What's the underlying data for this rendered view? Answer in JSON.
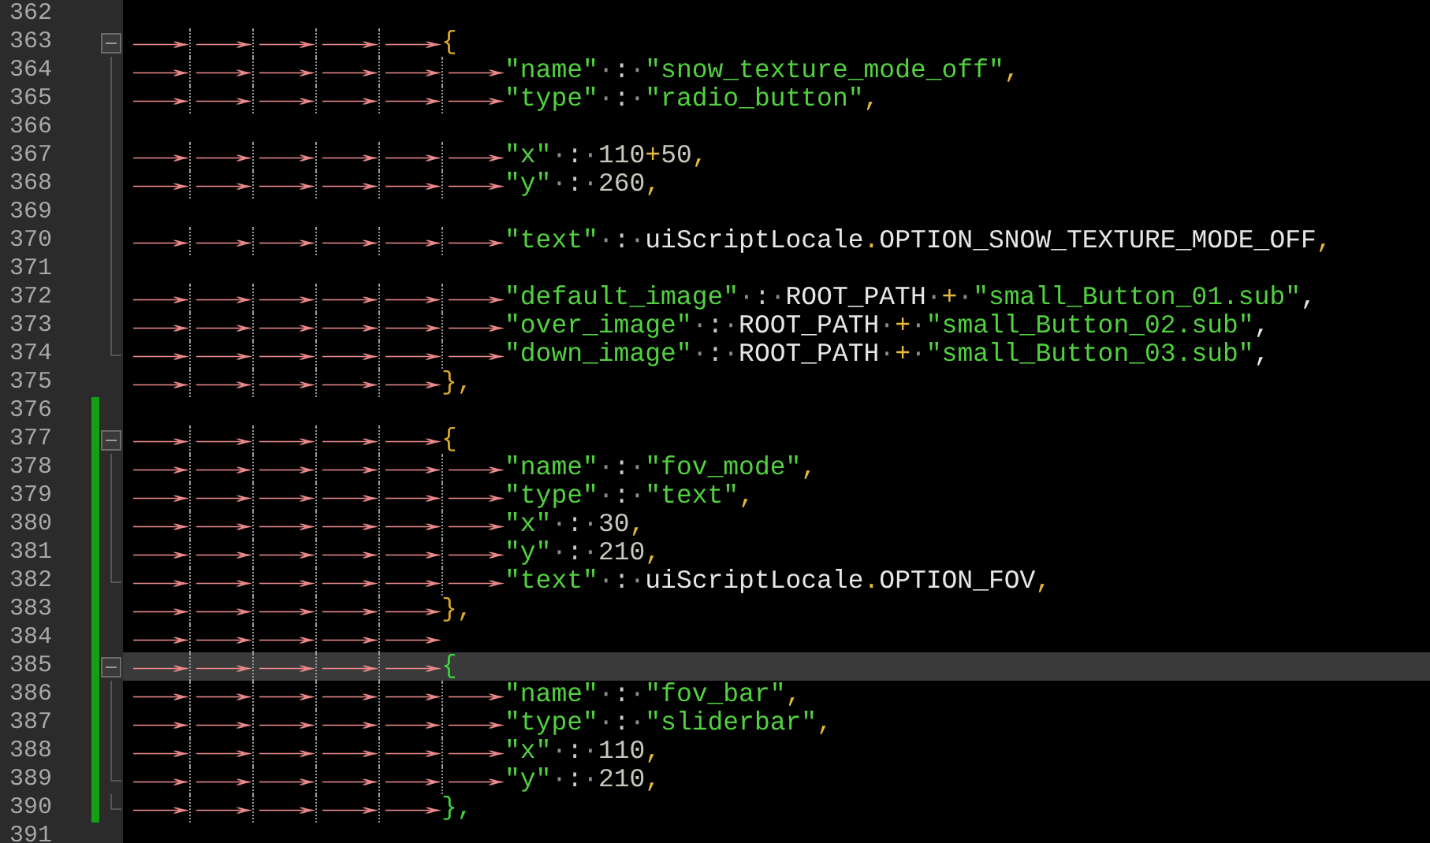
{
  "editor": {
    "lines": [
      {
        "number": "362",
        "expanded": false,
        "in_fold": false,
        "fold_end": false,
        "changed": false,
        "current": false
      },
      {
        "number": "363",
        "tokens": [
          {
            "text": "→",
            "kind": "tab"
          },
          {
            "text": "→",
            "kind": "tab"
          },
          {
            "text": "→",
            "kind": "tab"
          },
          {
            "text": "→",
            "kind": "tab"
          },
          {
            "text": "→",
            "kind": "tab"
          },
          {
            "text": "{",
            "kind": "brace"
          }
        ],
        "expanded": true,
        "in_fold": false,
        "fold_end": false,
        "changed": false,
        "current": false
      },
      {
        "number": "364",
        "tokens": [
          {
            "text": "→",
            "kind": "tab"
          },
          {
            "text": "→",
            "kind": "tab"
          },
          {
            "text": "→",
            "kind": "tab"
          },
          {
            "text": "→",
            "kind": "tab"
          },
          {
            "text": "→",
            "kind": "tab"
          },
          {
            "text": "→",
            "kind": "tab"
          },
          {
            "text": "\"name\"",
            "kind": "string"
          },
          {
            "text": "·",
            "kind": "space"
          },
          {
            "text": ":",
            "kind": "colon"
          },
          {
            "text": "·",
            "kind": "space"
          },
          {
            "text": "\"snow_texture_mode_off\"",
            "kind": "string"
          },
          {
            "text": ",",
            "kind": "operator"
          }
        ],
        "expanded": false,
        "in_fold": true,
        "fold_end": false,
        "changed": false,
        "current": false
      },
      {
        "number": "365",
        "tokens": [
          {
            "text": "→",
            "kind": "tab"
          },
          {
            "text": "→",
            "kind": "tab"
          },
          {
            "text": "→",
            "kind": "tab"
          },
          {
            "text": "→",
            "kind": "tab"
          },
          {
            "text": "→",
            "kind": "tab"
          },
          {
            "text": "→",
            "kind": "tab"
          },
          {
            "text": "\"type\"",
            "kind": "string"
          },
          {
            "text": "·",
            "kind": "space"
          },
          {
            "text": ":",
            "kind": "colon"
          },
          {
            "text": "·",
            "kind": "space"
          },
          {
            "text": "\"radio_button\"",
            "kind": "string"
          },
          {
            "text": ",",
            "kind": "operator"
          }
        ],
        "expanded": false,
        "in_fold": true,
        "fold_end": false,
        "changed": false,
        "current": false
      },
      {
        "number": "366",
        "expanded": false,
        "in_fold": true,
        "fold_end": false,
        "changed": false,
        "current": false
      },
      {
        "number": "367",
        "tokens": [
          {
            "text": "→",
            "kind": "tab"
          },
          {
            "text": "→",
            "kind": "tab"
          },
          {
            "text": "→",
            "kind": "tab"
          },
          {
            "text": "→",
            "kind": "tab"
          },
          {
            "text": "→",
            "kind": "tab"
          },
          {
            "text": "→",
            "kind": "tab"
          },
          {
            "text": "\"x\"",
            "kind": "string"
          },
          {
            "text": "·",
            "kind": "space"
          },
          {
            "text": ":",
            "kind": "colon"
          },
          {
            "text": "·",
            "kind": "space"
          },
          {
            "text": "110",
            "kind": "number"
          },
          {
            "text": "+",
            "kind": "operator"
          },
          {
            "text": "50",
            "kind": "number"
          },
          {
            "text": ",",
            "kind": "operator"
          }
        ],
        "expanded": false,
        "in_fold": true,
        "fold_end": false,
        "changed": false,
        "current": false
      },
      {
        "number": "368",
        "tokens": [
          {
            "text": "→",
            "kind": "tab"
          },
          {
            "text": "→",
            "kind": "tab"
          },
          {
            "text": "→",
            "kind": "tab"
          },
          {
            "text": "→",
            "kind": "tab"
          },
          {
            "text": "→",
            "kind": "tab"
          },
          {
            "text": "→",
            "kind": "tab"
          },
          {
            "text": "\"y\"",
            "kind": "string"
          },
          {
            "text": "·",
            "kind": "space"
          },
          {
            "text": ":",
            "kind": "colon"
          },
          {
            "text": "·",
            "kind": "space"
          },
          {
            "text": "260",
            "kind": "number"
          },
          {
            "text": ",",
            "kind": "operator"
          }
        ],
        "expanded": false,
        "in_fold": true,
        "fold_end": false,
        "changed": false,
        "current": false
      },
      {
        "number": "369",
        "expanded": false,
        "in_fold": true,
        "fold_end": false,
        "changed": false,
        "current": false
      },
      {
        "number": "370",
        "tokens": [
          {
            "text": "→",
            "kind": "tab"
          },
          {
            "text": "→",
            "kind": "tab"
          },
          {
            "text": "→",
            "kind": "tab"
          },
          {
            "text": "→",
            "kind": "tab"
          },
          {
            "text": "→",
            "kind": "tab"
          },
          {
            "text": "→",
            "kind": "tab"
          },
          {
            "text": "\"text\"",
            "kind": "string"
          },
          {
            "text": "·",
            "kind": "space"
          },
          {
            "text": ":",
            "kind": "colon"
          },
          {
            "text": "·",
            "kind": "space"
          },
          {
            "text": "uiScriptLocale",
            "kind": "identifier"
          },
          {
            "text": ".",
            "kind": "operator"
          },
          {
            "text": "OPTION_SNOW_TEXTURE_MODE_OFF",
            "kind": "identifier"
          },
          {
            "text": ",",
            "kind": "operator"
          }
        ],
        "expanded": false,
        "in_fold": true,
        "fold_end": false,
        "changed": false,
        "current": false
      },
      {
        "number": "371",
        "expanded": false,
        "in_fold": true,
        "fold_end": false,
        "changed": false,
        "current": false
      },
      {
        "number": "372",
        "tokens": [
          {
            "text": "→",
            "kind": "tab"
          },
          {
            "text": "→",
            "kind": "tab"
          },
          {
            "text": "→",
            "kind": "tab"
          },
          {
            "text": "→",
            "kind": "tab"
          },
          {
            "text": "→",
            "kind": "tab"
          },
          {
            "text": "→",
            "kind": "tab"
          },
          {
            "text": "\"default_image\"",
            "kind": "string"
          },
          {
            "text": "·",
            "kind": "space"
          },
          {
            "text": ":",
            "kind": "colon"
          },
          {
            "text": "·",
            "kind": "space"
          },
          {
            "text": "ROOT_PATH",
            "kind": "identifier"
          },
          {
            "text": "·",
            "kind": "space"
          },
          {
            "text": "+",
            "kind": "operator"
          },
          {
            "text": "·",
            "kind": "space"
          },
          {
            "text": "\"small_Button_01.sub\"",
            "kind": "string"
          },
          {
            "text": ",",
            "kind": "identifier"
          }
        ],
        "expanded": false,
        "in_fold": true,
        "fold_end": false,
        "changed": false,
        "current": false
      },
      {
        "number": "373",
        "tokens": [
          {
            "text": "→",
            "kind": "tab"
          },
          {
            "text": "→",
            "kind": "tab"
          },
          {
            "text": "→",
            "kind": "tab"
          },
          {
            "text": "→",
            "kind": "tab"
          },
          {
            "text": "→",
            "kind": "tab"
          },
          {
            "text": "→",
            "kind": "tab"
          },
          {
            "text": "\"over_image\"",
            "kind": "string"
          },
          {
            "text": "·",
            "kind": "space"
          },
          {
            "text": ":",
            "kind": "colon"
          },
          {
            "text": "·",
            "kind": "space"
          },
          {
            "text": "ROOT_PATH",
            "kind": "identifier"
          },
          {
            "text": "·",
            "kind": "space"
          },
          {
            "text": "+",
            "kind": "operator"
          },
          {
            "text": "·",
            "kind": "space"
          },
          {
            "text": "\"small_Button_02.sub\"",
            "kind": "string"
          },
          {
            "text": ",",
            "kind": "identifier"
          }
        ],
        "expanded": false,
        "in_fold": true,
        "fold_end": false,
        "changed": false,
        "current": false
      },
      {
        "number": "374",
        "tokens": [
          {
            "text": "→",
            "kind": "tab"
          },
          {
            "text": "→",
            "kind": "tab"
          },
          {
            "text": "→",
            "kind": "tab"
          },
          {
            "text": "→",
            "kind": "tab"
          },
          {
            "text": "→",
            "kind": "tab"
          },
          {
            "text": "→",
            "kind": "tab"
          },
          {
            "text": "\"down_image\"",
            "kind": "string"
          },
          {
            "text": "·",
            "kind": "space"
          },
          {
            "text": ":",
            "kind": "colon"
          },
          {
            "text": "·",
            "kind": "space"
          },
          {
            "text": "ROOT_PATH",
            "kind": "identifier"
          },
          {
            "text": "·",
            "kind": "space"
          },
          {
            "text": "+",
            "kind": "operator"
          },
          {
            "text": "·",
            "kind": "space"
          },
          {
            "text": "\"small_Button_03.sub\"",
            "kind": "string"
          },
          {
            "text": ",",
            "kind": "identifier"
          }
        ],
        "expanded": false,
        "in_fold": true,
        "fold_end": true,
        "changed": false,
        "current": false
      },
      {
        "number": "375",
        "tokens": [
          {
            "text": "→",
            "kind": "tab"
          },
          {
            "text": "→",
            "kind": "tab"
          },
          {
            "text": "→",
            "kind": "tab"
          },
          {
            "text": "→",
            "kind": "tab"
          },
          {
            "text": "→",
            "kind": "tab"
          },
          {
            "text": "},",
            "kind": "brace"
          }
        ],
        "expanded": false,
        "in_fold": false,
        "fold_end": false,
        "changed": false,
        "current": false
      },
      {
        "number": "376",
        "expanded": false,
        "in_fold": false,
        "fold_end": false,
        "changed": true,
        "current": false
      },
      {
        "number": "377",
        "tokens": [
          {
            "text": "→",
            "kind": "tab"
          },
          {
            "text": "→",
            "kind": "tab"
          },
          {
            "text": "→",
            "kind": "tab"
          },
          {
            "text": "→",
            "kind": "tab"
          },
          {
            "text": "→",
            "kind": "tab"
          },
          {
            "text": "{",
            "kind": "brace"
          }
        ],
        "expanded": true,
        "in_fold": false,
        "fold_end": false,
        "changed": true,
        "current": false
      },
      {
        "number": "378",
        "tokens": [
          {
            "text": "→",
            "kind": "tab"
          },
          {
            "text": "→",
            "kind": "tab"
          },
          {
            "text": "→",
            "kind": "tab"
          },
          {
            "text": "→",
            "kind": "tab"
          },
          {
            "text": "→",
            "kind": "tab"
          },
          {
            "text": "→",
            "kind": "tab"
          },
          {
            "text": "\"name\"",
            "kind": "string"
          },
          {
            "text": "·",
            "kind": "space"
          },
          {
            "text": ":",
            "kind": "colon"
          },
          {
            "text": "·",
            "kind": "space"
          },
          {
            "text": "\"fov_mode\"",
            "kind": "string"
          },
          {
            "text": ",",
            "kind": "operator"
          }
        ],
        "expanded": false,
        "in_fold": true,
        "fold_end": false,
        "changed": true,
        "current": false
      },
      {
        "number": "379",
        "tokens": [
          {
            "text": "→",
            "kind": "tab"
          },
          {
            "text": "→",
            "kind": "tab"
          },
          {
            "text": "→",
            "kind": "tab"
          },
          {
            "text": "→",
            "kind": "tab"
          },
          {
            "text": "→",
            "kind": "tab"
          },
          {
            "text": "→",
            "kind": "tab"
          },
          {
            "text": "\"type\"",
            "kind": "string"
          },
          {
            "text": "·",
            "kind": "space"
          },
          {
            "text": ":",
            "kind": "colon"
          },
          {
            "text": "·",
            "kind": "space"
          },
          {
            "text": "\"text\"",
            "kind": "string"
          },
          {
            "text": ",",
            "kind": "operator"
          }
        ],
        "expanded": false,
        "in_fold": true,
        "fold_end": false,
        "changed": true,
        "current": false
      },
      {
        "number": "380",
        "tokens": [
          {
            "text": "→",
            "kind": "tab"
          },
          {
            "text": "→",
            "kind": "tab"
          },
          {
            "text": "→",
            "kind": "tab"
          },
          {
            "text": "→",
            "kind": "tab"
          },
          {
            "text": "→",
            "kind": "tab"
          },
          {
            "text": "→",
            "kind": "tab"
          },
          {
            "text": "\"x\"",
            "kind": "string"
          },
          {
            "text": "·",
            "kind": "space"
          },
          {
            "text": ":",
            "kind": "colon"
          },
          {
            "text": "·",
            "kind": "space"
          },
          {
            "text": "30",
            "kind": "number"
          },
          {
            "text": ",",
            "kind": "operator"
          }
        ],
        "expanded": false,
        "in_fold": true,
        "fold_end": false,
        "changed": true,
        "current": false
      },
      {
        "number": "381",
        "tokens": [
          {
            "text": "→",
            "kind": "tab"
          },
          {
            "text": "→",
            "kind": "tab"
          },
          {
            "text": "→",
            "kind": "tab"
          },
          {
            "text": "→",
            "kind": "tab"
          },
          {
            "text": "→",
            "kind": "tab"
          },
          {
            "text": "→",
            "kind": "tab"
          },
          {
            "text": "\"y\"",
            "kind": "string"
          },
          {
            "text": "·",
            "kind": "space"
          },
          {
            "text": ":",
            "kind": "colon"
          },
          {
            "text": "·",
            "kind": "space"
          },
          {
            "text": "210",
            "kind": "number"
          },
          {
            "text": ",",
            "kind": "operator"
          }
        ],
        "expanded": false,
        "in_fold": true,
        "fold_end": false,
        "changed": true,
        "current": false
      },
      {
        "number": "382",
        "tokens": [
          {
            "text": "→",
            "kind": "tab"
          },
          {
            "text": "→",
            "kind": "tab"
          },
          {
            "text": "→",
            "kind": "tab"
          },
          {
            "text": "→",
            "kind": "tab"
          },
          {
            "text": "→",
            "kind": "tab"
          },
          {
            "text": "→",
            "kind": "tab"
          },
          {
            "text": "\"text\"",
            "kind": "string"
          },
          {
            "text": "·",
            "kind": "space"
          },
          {
            "text": ":",
            "kind": "colon"
          },
          {
            "text": "·",
            "kind": "space"
          },
          {
            "text": "uiScriptLocale",
            "kind": "identifier"
          },
          {
            "text": ".",
            "kind": "operator"
          },
          {
            "text": "OPTION_FOV",
            "kind": "identifier"
          },
          {
            "text": ",",
            "kind": "operator"
          }
        ],
        "expanded": false,
        "in_fold": true,
        "fold_end": true,
        "changed": true,
        "current": false
      },
      {
        "number": "383",
        "tokens": [
          {
            "text": "→",
            "kind": "tab"
          },
          {
            "text": "→",
            "kind": "tab"
          },
          {
            "text": "→",
            "kind": "tab"
          },
          {
            "text": "→",
            "kind": "tab"
          },
          {
            "text": "→",
            "kind": "tab"
          },
          {
            "text": "},",
            "kind": "brace"
          }
        ],
        "expanded": false,
        "in_fold": false,
        "fold_end": false,
        "changed": true,
        "current": false
      },
      {
        "number": "384",
        "tokens": [
          {
            "text": "→",
            "kind": "tab"
          },
          {
            "text": "→",
            "kind": "tab"
          },
          {
            "text": "→",
            "kind": "tab"
          },
          {
            "text": "→",
            "kind": "tab"
          },
          {
            "text": "→",
            "kind": "tab"
          }
        ],
        "expanded": false,
        "in_fold": false,
        "fold_end": false,
        "changed": true,
        "current": false
      },
      {
        "number": "385",
        "tokens": [
          {
            "text": "→",
            "kind": "tab"
          },
          {
            "text": "→",
            "kind": "tab"
          },
          {
            "text": "→",
            "kind": "tab"
          },
          {
            "text": "→",
            "kind": "tab"
          },
          {
            "text": "→",
            "kind": "tab"
          },
          {
            "text": "{",
            "kind": "brace-match"
          }
        ],
        "expanded": true,
        "in_fold": false,
        "fold_end": false,
        "changed": true,
        "current": true
      },
      {
        "number": "386",
        "tokens": [
          {
            "text": "→",
            "kind": "tab"
          },
          {
            "text": "→",
            "kind": "tab"
          },
          {
            "text": "→",
            "kind": "tab"
          },
          {
            "text": "→",
            "kind": "tab"
          },
          {
            "text": "→",
            "kind": "tab"
          },
          {
            "text": "→",
            "kind": "tab"
          },
          {
            "text": "\"name\"",
            "kind": "string"
          },
          {
            "text": "·",
            "kind": "space"
          },
          {
            "text": ":",
            "kind": "colon"
          },
          {
            "text": "·",
            "kind": "space"
          },
          {
            "text": "\"fov_bar\"",
            "kind": "string"
          },
          {
            "text": ",",
            "kind": "operator"
          }
        ],
        "expanded": false,
        "in_fold": true,
        "fold_end": false,
        "changed": true,
        "current": false
      },
      {
        "number": "387",
        "tokens": [
          {
            "text": "→",
            "kind": "tab"
          },
          {
            "text": "→",
            "kind": "tab"
          },
          {
            "text": "→",
            "kind": "tab"
          },
          {
            "text": "→",
            "kind": "tab"
          },
          {
            "text": "→",
            "kind": "tab"
          },
          {
            "text": "→",
            "kind": "tab"
          },
          {
            "text": "\"type\"",
            "kind": "string"
          },
          {
            "text": "·",
            "kind": "space"
          },
          {
            "text": ":",
            "kind": "colon"
          },
          {
            "text": "·",
            "kind": "space"
          },
          {
            "text": "\"sliderbar\"",
            "kind": "string"
          },
          {
            "text": ",",
            "kind": "operator"
          }
        ],
        "expanded": false,
        "in_fold": true,
        "fold_end": false,
        "changed": true,
        "current": false
      },
      {
        "number": "388",
        "tokens": [
          {
            "text": "→",
            "kind": "tab"
          },
          {
            "text": "→",
            "kind": "tab"
          },
          {
            "text": "→",
            "kind": "tab"
          },
          {
            "text": "→",
            "kind": "tab"
          },
          {
            "text": "→",
            "kind": "tab"
          },
          {
            "text": "→",
            "kind": "tab"
          },
          {
            "text": "\"x\"",
            "kind": "string"
          },
          {
            "text": "·",
            "kind": "space"
          },
          {
            "text": ":",
            "kind": "colon"
          },
          {
            "text": "·",
            "kind": "space"
          },
          {
            "text": "110",
            "kind": "number"
          },
          {
            "text": ",",
            "kind": "operator"
          }
        ],
        "expanded": false,
        "in_fold": true,
        "fold_end": false,
        "changed": true,
        "current": false
      },
      {
        "number": "389",
        "tokens": [
          {
            "text": "→",
            "kind": "tab"
          },
          {
            "text": "→",
            "kind": "tab"
          },
          {
            "text": "→",
            "kind": "tab"
          },
          {
            "text": "→",
            "kind": "tab"
          },
          {
            "text": "→",
            "kind": "tab"
          },
          {
            "text": "→",
            "kind": "tab"
          },
          {
            "text": "\"y\"",
            "kind": "string"
          },
          {
            "text": "·",
            "kind": "space"
          },
          {
            "text": ":",
            "kind": "colon"
          },
          {
            "text": "·",
            "kind": "space"
          },
          {
            "text": "210",
            "kind": "number"
          },
          {
            "text": ",",
            "kind": "operator"
          }
        ],
        "expanded": false,
        "in_fold": true,
        "fold_end": true,
        "changed": true,
        "current": false
      },
      {
        "number": "390",
        "tokens": [
          {
            "text": "→",
            "kind": "tab"
          },
          {
            "text": "→",
            "kind": "tab"
          },
          {
            "text": "→",
            "kind": "tab"
          },
          {
            "text": "→",
            "kind": "tab"
          },
          {
            "text": "→",
            "kind": "tab"
          },
          {
            "text": "},",
            "kind": "brace-match"
          }
        ],
        "expanded": false,
        "in_fold": true,
        "fold_end": true,
        "changed": true,
        "current": false
      },
      {
        "number": "391",
        "expanded": false,
        "in_fold": false,
        "fold_end": false,
        "changed": false,
        "current": false
      }
    ]
  }
}
